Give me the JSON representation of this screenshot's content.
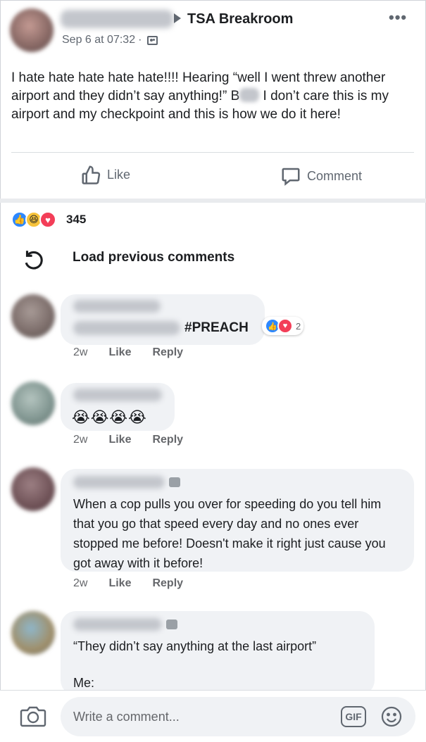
{
  "post": {
    "group_name": "TSA Breakroom",
    "date": "Sep 6 at 07:32",
    "separator": "·",
    "more_label": "•••",
    "body_part1": "I hate hate hate hate hate!!!! Hearing “well I went threw another airport and they didn’t say anything!” B",
    "body_part2": " I don’t care this is my airport and my checkpoint and this is how we do it here!",
    "actions": {
      "like": "Like",
      "comment": "Comment"
    },
    "reaction_count": "345",
    "reaction_icons": [
      "like-reaction-icon",
      "haha-reaction-icon",
      "love-reaction-icon"
    ]
  },
  "load_previous": "Load previous comments",
  "comments": [
    {
      "text": "#PREACH",
      "time": "2w",
      "like": "Like",
      "reply": "Reply",
      "reaction_count": "2"
    },
    {
      "text": "😭😭😭😭",
      "time": "2w",
      "like": "Like",
      "reply": "Reply"
    },
    {
      "text": "When a cop pulls you over for speeding do you tell him that you go that speed every day and no ones ever stopped me before! Doesn't make it right just cause you got away with it before!",
      "time": "2w",
      "like": "Like",
      "reply": "Reply"
    },
    {
      "text_line1": "“They didn’t say anything at the last airport”",
      "text_line2": "Me:"
    }
  ],
  "composer": {
    "placeholder": "Write a comment...",
    "gif_label": "GIF"
  },
  "colors": {
    "accent": "#2d88ff",
    "love": "#f33e58",
    "haha": "#f7c33b",
    "text_secondary": "#606770",
    "bubble": "#f0f2f5"
  }
}
